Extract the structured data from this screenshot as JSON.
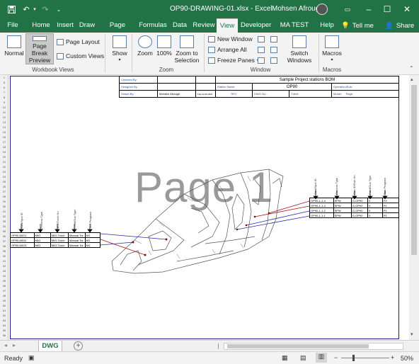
{
  "window": {
    "title": "OP90-DRAWING-01.xlsx - Excel",
    "user": "Mohsen Afrough",
    "accent": "#217346"
  },
  "tabs": [
    {
      "label": "File"
    },
    {
      "label": "Home"
    },
    {
      "label": "Insert"
    },
    {
      "label": "Draw"
    },
    {
      "label": "Page Layout"
    },
    {
      "label": "Formulas"
    },
    {
      "label": "Data"
    },
    {
      "label": "Review"
    },
    {
      "label": "View"
    },
    {
      "label": "Developer"
    },
    {
      "label": "MA TEST TAB"
    },
    {
      "label": "Help"
    }
  ],
  "tell_me": "Tell me",
  "share": "Share",
  "ribbon": {
    "normal": "Normal",
    "page_break_preview": "Page Break Preview",
    "page_layout": "Page Layout",
    "custom_views": "Custom Views",
    "workbook_views": "Workbook Views",
    "show": "Show",
    "zoom": "Zoom",
    "zoom_100": "100%",
    "zoom_selection": "Zoom to Selection",
    "zoom_group": "Zoom",
    "new_window": "New Window",
    "arrange_all": "Arrange All",
    "freeze_panes": "Freeze Panes",
    "switch_windows": "Switch Windows",
    "window_group": "Window",
    "macros": "Macros",
    "macros_group": "Macros"
  },
  "sheet": {
    "watermark": "Page 1",
    "title_block": {
      "checked_by": "Checked By:",
      "designed_by": "Designed By:",
      "drawn_by": "Drawn By:",
      "drawn_name": "Mohsen Afrough",
      "drawn_date": "Feb-22-09-2021",
      "project": "Sample Project stations BOM",
      "station_name": "Station Name:",
      "station_value": "OP90",
      "operation_robot": "Operation/Rob:",
      "rev": "REV",
      "dwg_no": "DWG No.:",
      "client": "Client:",
      "model": "Model:",
      "page": "Page:"
    },
    "left_table": {
      "headers": [
        "Stud/Spot ID",
        "Process Type",
        "MIG/Torch No",
        "Feed/Gun Type",
        "Tool Program"
      ],
      "rows": [
        [
          "OP90-MIG1",
          "MIG",
          "MIG-Torch",
          "Manual Tor",
          "M1"
        ],
        [
          "OP90-MIG2",
          "MIG",
          "MIG-Torch",
          "Manual Tor",
          "M1"
        ],
        [
          "OP90-MIG3",
          "MIG",
          "MIG-Torch",
          "Manual Tor",
          "M1"
        ]
      ]
    },
    "right_table": {
      "headers": [
        "Stud/Spot ID",
        "Process Type",
        "Gun ID/Gun No",
        "Feed/Gun Type",
        "Tool Program"
      ],
      "rows": [
        [
          "OP90-1-1-4",
          "SPW",
          "G-OP90",
          "X",
          "P2"
        ],
        [
          "OP90-1-1-3",
          "SPW",
          "G-OP90",
          "X",
          "P1"
        ],
        [
          "OP90-1-1-2",
          "SPW",
          "G-OP90",
          "X",
          "P1"
        ],
        [
          "OP90-1-1-1",
          "SPW",
          "G-OP90",
          "X",
          "P1"
        ]
      ]
    },
    "row_numbers": [
      "1",
      "5",
      "6",
      "7",
      "8",
      "9",
      "10",
      "11",
      "12",
      "13",
      "14",
      "15",
      "16",
      "17",
      "18",
      "19",
      "20",
      "21",
      "22",
      "23",
      "24",
      "25",
      "26",
      "27",
      "28",
      "29",
      "30",
      "31",
      "32",
      "33",
      "34",
      "35",
      "36",
      "37",
      "38",
      "39",
      "40",
      "41",
      "42",
      "43",
      "44",
      "45",
      "46",
      "47",
      "48",
      "49",
      "50",
      "51",
      "52",
      "53",
      "54",
      "55",
      "56"
    ]
  },
  "sheet_tab": "DWG",
  "status": {
    "ready": "Ready",
    "zoom": "50%"
  }
}
